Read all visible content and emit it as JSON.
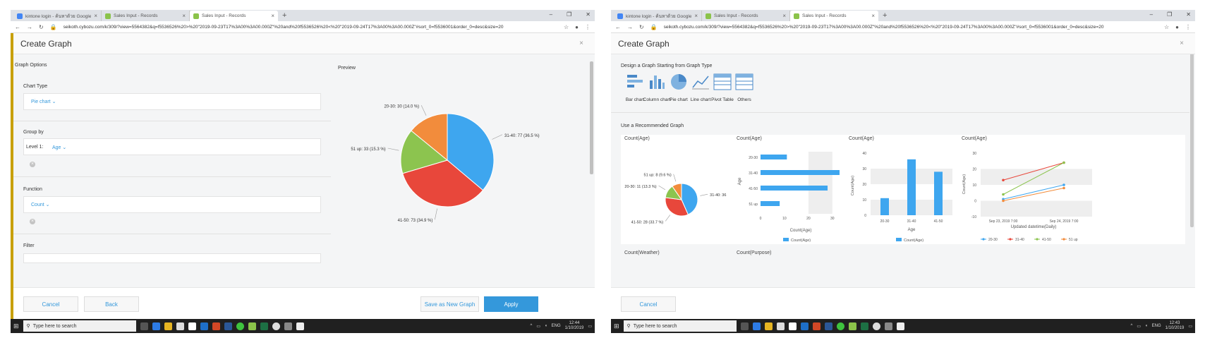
{
  "colors": {
    "accent": "#3498db",
    "blue": "#3ea6ef",
    "red": "#e8473b",
    "green": "#8cc44f",
    "orange": "#f28c3c"
  },
  "browser": {
    "tabs": [
      {
        "label": "kintone login - ค้นหาด้วย Google"
      },
      {
        "label": "Sales Input - Records"
      },
      {
        "label": "Sales Input - Records"
      }
    ],
    "url": "seikoth.cybozu.com/k/309/?view=5564382&q=f5536526%20>%20\"2019-09-23T17%3A00%3A00.000Z\"%20and%20f5536526%20<%20\"2019-09-24T17%3A00%3A00.000Z\"#sort_0=f5536001&order_0=desc&size=20"
  },
  "left": {
    "dialog_title": "Create Graph",
    "section_title": "Graph Options",
    "chart_type_label": "Chart Type",
    "chart_type_value": "Pie chart",
    "group_by_label": "Group by",
    "level_label": "Level 1:",
    "level_value": "Age",
    "function_label": "Function",
    "function_value": "Count",
    "filter_label": "Filter",
    "preview_label": "Preview",
    "buttons": {
      "cancel": "Cancel",
      "back": "Back",
      "save_new": "Save as New Graph",
      "apply": "Apply"
    },
    "pie_labels": {
      "a": "31-40: 77 (36.5 %)",
      "b": "41-50: 73 (34.9 %)",
      "c": "51 up: 33 (15.3 %)",
      "d": "20-30: 30 (14.0 %)"
    }
  },
  "right": {
    "dialog_title": "Create Graph",
    "design_label": "Design a Graph Starting from Graph Type",
    "graph_types": [
      {
        "label": "Bar chart",
        "icon": "bar-chart-icon"
      },
      {
        "label": "Column chart",
        "icon": "column-chart-icon"
      },
      {
        "label": "Pie chart",
        "icon": "pie-chart-icon"
      },
      {
        "label": "Line chart",
        "icon": "line-chart-icon"
      },
      {
        "label": "Pivot Table",
        "icon": "pivot-table-icon"
      },
      {
        "label": "Others",
        "icon": "others-icon"
      }
    ],
    "recommended_label": "Use a Recommended Graph",
    "panel_titles": [
      "Count(Age)",
      "Count(Age)",
      "Count(Age)",
      "Count(Age)"
    ],
    "lower_titles": [
      "Count(Weather)",
      "Count(Purpose)"
    ],
    "cancel": "Cancel",
    "pie_labels": {
      "a": "31-40: 36",
      "b": "41-50: 28 (33.7 %)",
      "c": "20-30: 11 (13.3 %)",
      "d": "51 up: 8 (9.6 %)"
    },
    "bar": {
      "ylabel": "Age",
      "xlabel": "Count(Age)",
      "legend": "Count(Age)",
      "cats": [
        "20-30",
        "31-40",
        "41-50",
        "51 up"
      ],
      "ticks": [
        "0",
        "10",
        "20",
        "30"
      ]
    },
    "column": {
      "ylabel": "Count(Age)",
      "xlabel": "Age",
      "legend": "Count(Age)",
      "cats": [
        "20-30",
        "31-40",
        "41-50"
      ],
      "ticks": [
        "40",
        "30",
        "20",
        "10",
        "0"
      ]
    },
    "line": {
      "ylabel": "Count(Age)",
      "xlabel": "Updated datetime(Daily)",
      "x": [
        "Sep 23, 2019 7:00",
        "Sep 24, 2019 7:00"
      ],
      "ticks": [
        "30",
        "20",
        "10",
        "0",
        "-10"
      ],
      "legend": [
        "20-30",
        "31-40",
        "41-50",
        "51 up"
      ]
    }
  },
  "taskbar": {
    "search_placeholder": "Type here to search",
    "lang": "ENG",
    "left_time": "12:44",
    "left_date": "1/10/2019",
    "right_time": "12:43",
    "right_date": "1/10/2019"
  },
  "chart_data": [
    {
      "type": "pie",
      "categories": [
        "31-40",
        "41-50",
        "51 up",
        "20-30"
      ],
      "values": [
        77,
        73,
        33,
        30
      ],
      "percent": [
        36.5,
        34.9,
        15.3,
        14.0
      ]
    },
    {
      "type": "pie",
      "categories": [
        "31-40",
        "41-50",
        "20-30",
        "51 up"
      ],
      "values": [
        36,
        28,
        11,
        8
      ],
      "percent": [
        43.4,
        33.7,
        13.3,
        9.6
      ]
    },
    {
      "type": "bar",
      "categories": [
        "20-30",
        "31-40",
        "41-50",
        "51 up"
      ],
      "values": [
        11,
        33,
        28,
        8
      ],
      "xlabel": "Count(Age)",
      "ylabel": "Age",
      "xlim": [
        0,
        33
      ]
    },
    {
      "type": "bar",
      "categories": [
        "20-30",
        "31-40",
        "41-50"
      ],
      "values": [
        11,
        36,
        28
      ],
      "xlabel": "Age",
      "ylabel": "Count(Age)",
      "ylim": [
        0,
        40
      ]
    },
    {
      "type": "line",
      "x": [
        "Sep 23, 2019 7:00",
        "Sep 24, 2019 7:00"
      ],
      "series": [
        {
          "name": "20-30",
          "values": [
            1,
            10
          ]
        },
        {
          "name": "31-40",
          "values": [
            13,
            24
          ]
        },
        {
          "name": "41-50",
          "values": [
            4,
            24
          ]
        },
        {
          "name": "51 up",
          "values": [
            0,
            8
          ]
        }
      ],
      "xlabel": "Updated datetime(Daily)",
      "ylabel": "Count(Age)",
      "ylim": [
        -10,
        30
      ]
    }
  ]
}
